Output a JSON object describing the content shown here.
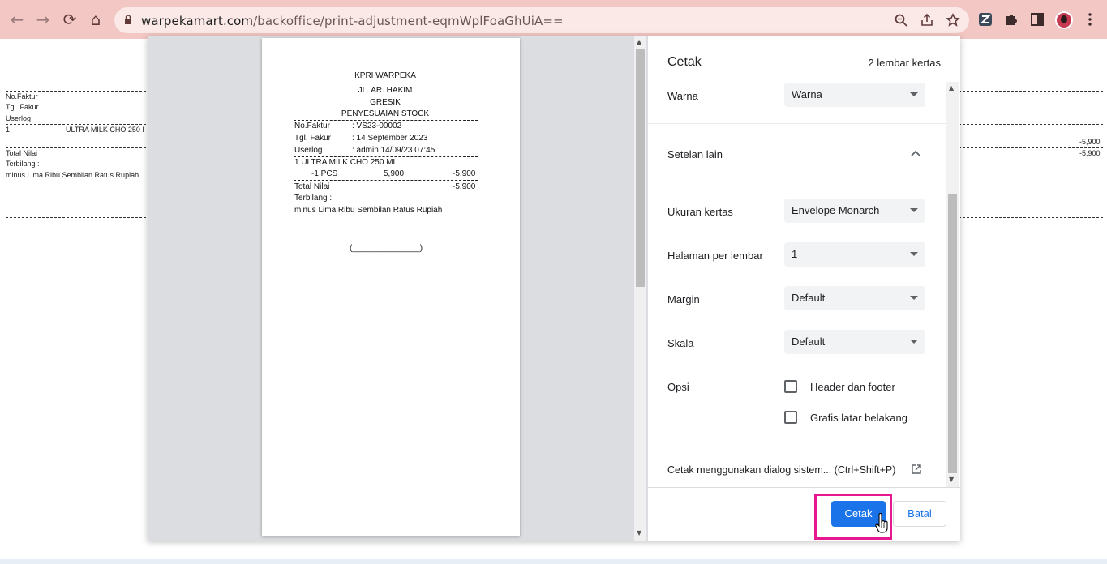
{
  "browser": {
    "url_host": "warpekamart.com",
    "url_path": "/backoffice/print-adjustment-eqmWplFoaGhUiA==",
    "nav_back": "←",
    "nav_forward": "→",
    "nav_reload": "⟳",
    "nav_home": "⌂",
    "icons": [
      "zoom-icon",
      "share-icon",
      "bookmark-star-icon",
      "extension-z-icon",
      "puzzle-icon",
      "sidepanel-icon",
      "avatar",
      "menu-icon"
    ]
  },
  "page": {
    "no_faktur": "No.Faktur",
    "tgl_fakur": "Tgl. Fakur",
    "userlog": "Userlog",
    "row_no": "1",
    "row_item": "ULTRA MILK CHO 250 I",
    "total_nilai": "Total Nilai",
    "terbilang": "Terbilang :",
    "terbilang_text": "minus Lima Ribu Sembilan Ratus Rupiah",
    "amount_a": "-5,900",
    "amount_b": "-5,900"
  },
  "receipt": {
    "store": "KPRI WARPEKA",
    "address": "JL. AR. HAKIM",
    "city": "GRESIK",
    "doc_title": "PENYESUAIAN STOCK",
    "faktur_label": "No.Faktur",
    "faktur_value": ": VS23-00002",
    "tgl_label": "Tgl. Fakur",
    "tgl_value": ": 14 September 2023",
    "user_label": "Userlog",
    "user_value": ": admin 14/09/23 07:45",
    "item_line": "1  ULTRA MILK CHO 250 ML",
    "item_qty": "-1  PCS",
    "item_price": "5,900",
    "item_total": "-5,900",
    "total_label": "Total Nilai",
    "total_value": "-5,900",
    "terbilang_label": "Terbilang :",
    "terbilang_text": "minus Lima Ribu Sembilan Ratus Rupiah",
    "signature": "(_______________)"
  },
  "print_dialog": {
    "title": "Cetak",
    "sheet_count": "2 lembar kertas",
    "warna_label": "Warna",
    "warna_value": "Warna",
    "setelan_lain": "Setelan lain",
    "ukuran_label": "Ukuran kertas",
    "ukuran_value": "Envelope Monarch",
    "halaman_label": "Halaman per lembar",
    "halaman_value": "1",
    "margin_label": "Margin",
    "margin_value": "Default",
    "skala_label": "Skala",
    "skala_value": "Default",
    "opsi_label": "Opsi",
    "opt_header_footer": "Header dan footer",
    "opt_header_footer_checked": false,
    "opt_grafis": "Grafis latar belakang",
    "opt_grafis_checked": false,
    "system_dialog": "Cetak menggunakan dialog sistem... (Ctrl+Shift+P)",
    "btn_print": "Cetak",
    "btn_cancel": "Batal"
  },
  "colors": {
    "toolbar": "#f2c7c4",
    "primary_button": "#1a73e8",
    "highlight": "#e6178f"
  }
}
